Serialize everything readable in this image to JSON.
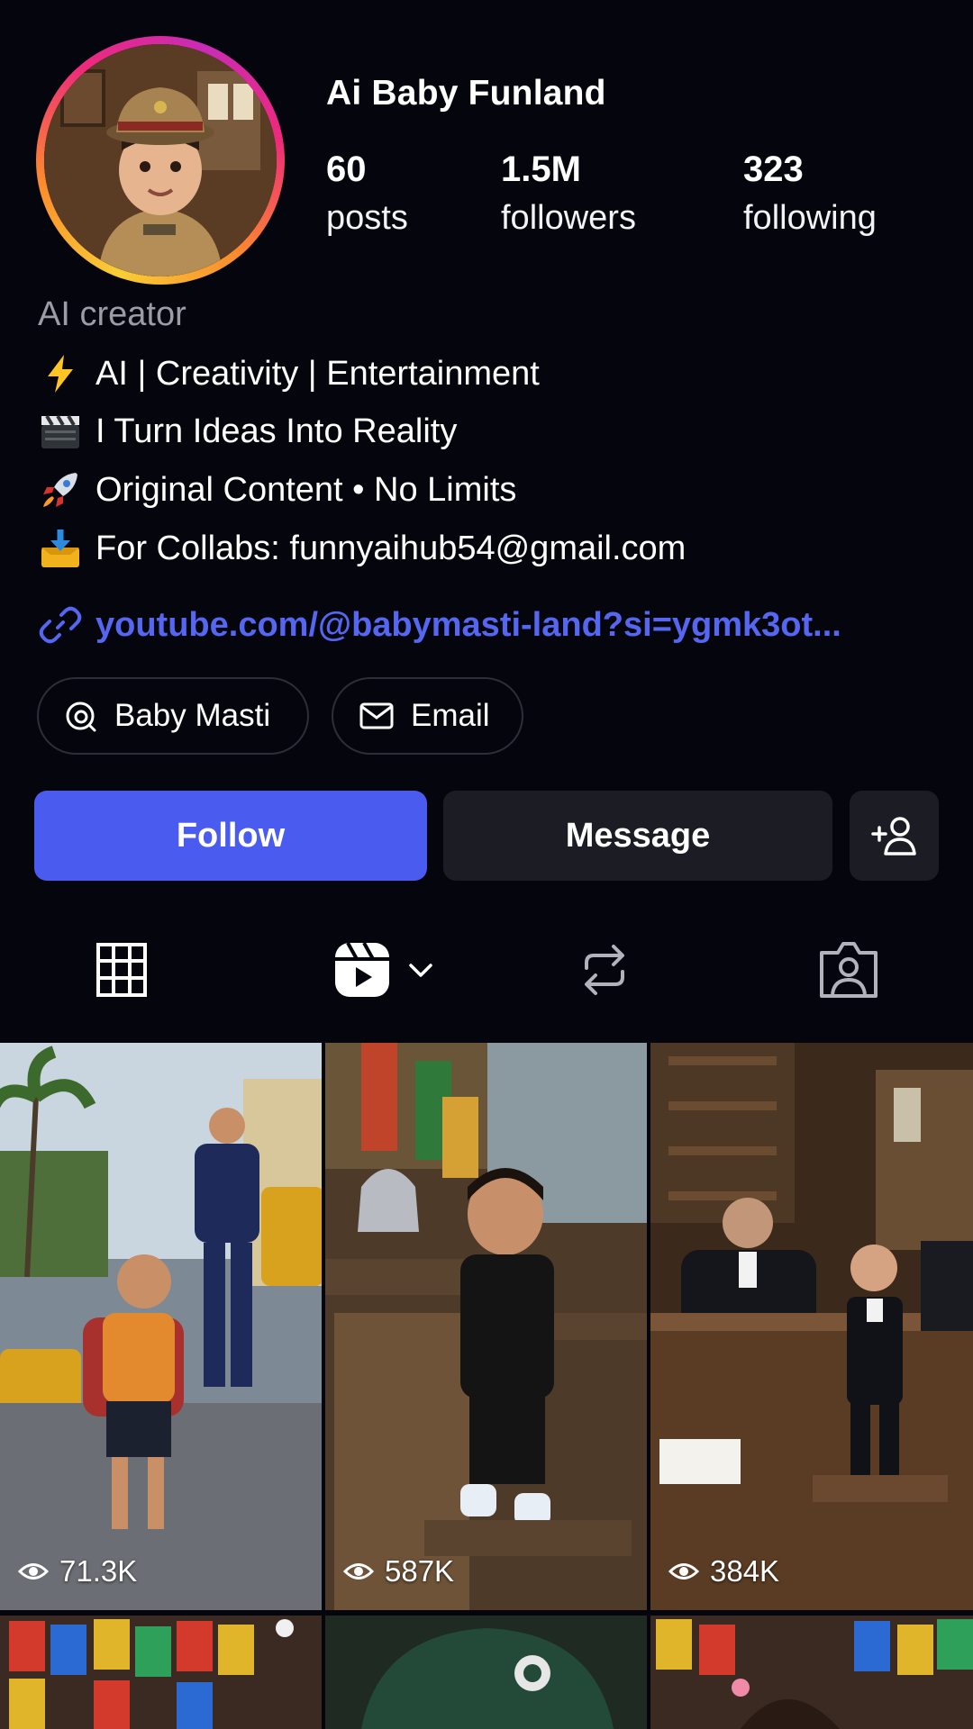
{
  "profile": {
    "username": "Ai Baby Funland",
    "stats": [
      {
        "value": "60",
        "label": "posts"
      },
      {
        "value": "1.5M",
        "label": "followers"
      },
      {
        "value": "323",
        "label": "following"
      }
    ],
    "category": "AI creator",
    "bio_lines": [
      {
        "icon": "lightning-icon",
        "text": "AI | Creativity | Entertainment"
      },
      {
        "icon": "clapperboard-icon",
        "text": "I Turn Ideas Into Reality"
      },
      {
        "icon": "rocket-icon",
        "text": "Original Content • No Limits"
      },
      {
        "icon": "inbox-tray-icon",
        "text": "For Collabs: funnyaihub54@gmail.com"
      }
    ],
    "link": "youtube.com/@babymasti-land?si=ygmk3ot...",
    "pills": [
      {
        "icon": "threads-icon",
        "label": "Baby Masti"
      },
      {
        "icon": "mail-icon",
        "label": "Email"
      }
    ]
  },
  "actions": {
    "follow_label": "Follow",
    "message_label": "Message",
    "add_user_icon": "add-user-icon"
  },
  "tabs": [
    {
      "icon": "grid-icon",
      "active": false
    },
    {
      "icon": "reels-icon",
      "active": true
    },
    {
      "icon": "reposts-icon",
      "active": false
    },
    {
      "icon": "tagged-icon",
      "active": false
    }
  ],
  "posts": [
    {
      "views": "71.3K"
    },
    {
      "views": "587K"
    },
    {
      "views": "384K"
    }
  ],
  "colors": {
    "background": "#05060d",
    "accent": "#4a5bf0",
    "link": "#5566f0",
    "secondary_button": "#1c1d24",
    "muted_text": "#9a9ca6"
  }
}
